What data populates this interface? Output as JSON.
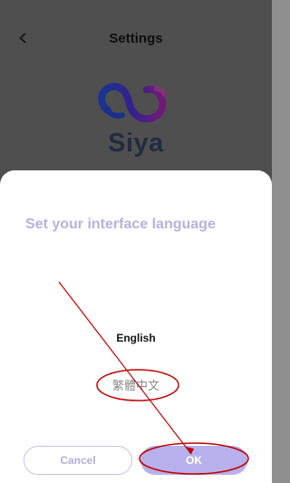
{
  "header": {
    "back_icon": "chevron-left-icon",
    "title": "Settings"
  },
  "logo": {
    "text": "Siya",
    "icon": "siya-logo-icon"
  },
  "dialog": {
    "title": "Set your interface language",
    "options": [
      {
        "label": "English",
        "selected": true
      },
      {
        "label": "繁體中文",
        "selected": false
      }
    ],
    "cancel_label": "Cancel",
    "ok_label": "OK"
  },
  "colors": {
    "accent": "#b7b0ec",
    "title": "#b8b0df",
    "annotation": "#c00000"
  }
}
